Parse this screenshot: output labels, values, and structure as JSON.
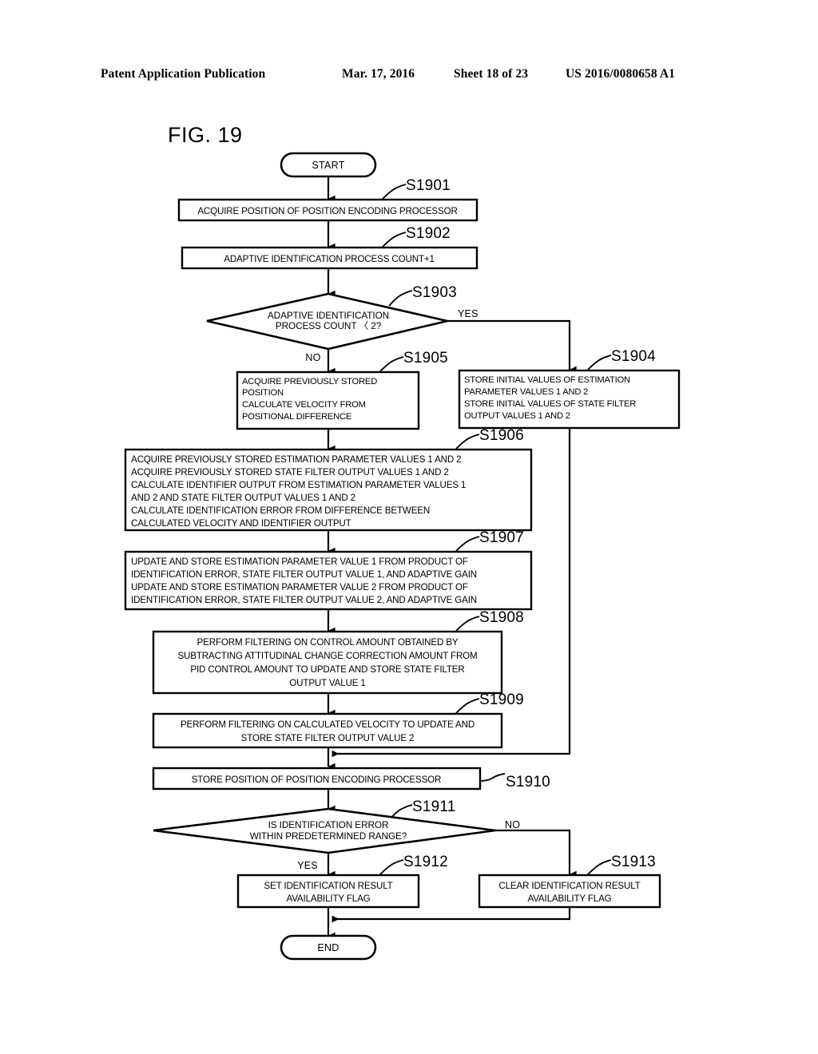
{
  "header": {
    "publication": "Patent Application Publication",
    "date": "Mar. 17, 2016",
    "sheet": "Sheet 18 of 23",
    "patent_number": "US 2016/0080658 A1"
  },
  "figure": {
    "title": "FIG. 19"
  },
  "chart_data": {
    "type": "diagram",
    "diagram_kind": "flowchart",
    "title": "FIG. 19",
    "nodes": [
      {
        "id": "start",
        "shape": "terminator",
        "label": "START"
      },
      {
        "id": "s1901",
        "shape": "process",
        "step": "S1901",
        "align": "center",
        "lines": [
          "ACQUIRE POSITION OF POSITION ENCODING PROCESSOR"
        ]
      },
      {
        "id": "s1902",
        "shape": "process",
        "step": "S1902",
        "align": "center",
        "lines": [
          "ADAPTIVE IDENTIFICATION PROCESS COUNT+1"
        ]
      },
      {
        "id": "s1903",
        "shape": "decision",
        "step": "S1903",
        "align": "center",
        "lines": [
          "ADAPTIVE IDENTIFICATION",
          "PROCESS COUNT 〈 2?"
        ],
        "branch_yes": "YES",
        "branch_no": "NO"
      },
      {
        "id": "s1905",
        "shape": "process",
        "step": "S1905",
        "align": "left",
        "lines": [
          "ACQUIRE PREVIOUSLY STORED",
          "POSITION",
          "CALCULATE VELOCITY FROM",
          "POSITIONAL DIFFERENCE"
        ]
      },
      {
        "id": "s1904",
        "shape": "process",
        "step": "S1904",
        "align": "left",
        "lines": [
          "STORE INITIAL VALUES OF ESTIMATION",
          "PARAMETER VALUES 1 AND 2",
          "STORE INITIAL VALUES OF STATE FILTER",
          "OUTPUT VALUES 1 AND 2"
        ]
      },
      {
        "id": "s1906",
        "shape": "process",
        "step": "S1906",
        "align": "left",
        "lines": [
          "ACQUIRE PREVIOUSLY STORED ESTIMATION PARAMETER VALUES 1 AND 2",
          "ACQUIRE PREVIOUSLY STORED STATE FILTER OUTPUT VALUES 1 AND 2",
          "CALCULATE IDENTIFIER OUTPUT FROM ESTIMATION PARAMETER VALUES 1",
          "AND 2 AND STATE FILTER OUTPUT VALUES 1 AND 2",
          "CALCULATE IDENTIFICATION ERROR FROM DIFFERENCE BETWEEN",
          "CALCULATED VELOCITY AND IDENTIFIER OUTPUT"
        ]
      },
      {
        "id": "s1907",
        "shape": "process",
        "step": "S1907",
        "align": "left",
        "lines": [
          "UPDATE AND STORE ESTIMATION PARAMETER VALUE 1 FROM PRODUCT OF",
          "IDENTIFICATION ERROR, STATE FILTER OUTPUT VALUE 1, AND ADAPTIVE GAIN",
          "UPDATE AND STORE ESTIMATION PARAMETER VALUE 2 FROM PRODUCT OF",
          "IDENTIFICATION ERROR, STATE FILTER OUTPUT VALUE 2, AND ADAPTIVE GAIN"
        ]
      },
      {
        "id": "s1908",
        "shape": "process",
        "step": "S1908",
        "align": "center",
        "lines": [
          "PERFORM FILTERING ON CONTROL AMOUNT OBTAINED BY",
          "SUBTRACTING ATTITUDINAL CHANGE CORRECTION AMOUNT FROM",
          "PID CONTROL AMOUNT TO UPDATE AND STORE STATE FILTER",
          "OUTPUT VALUE 1"
        ]
      },
      {
        "id": "s1909",
        "shape": "process",
        "step": "S1909",
        "align": "center",
        "lines": [
          "PERFORM FILTERING ON CALCULATED VELOCITY TO UPDATE AND",
          "STORE STATE FILTER OUTPUT VALUE 2"
        ]
      },
      {
        "id": "s1910",
        "shape": "process",
        "step": "S1910",
        "align": "center",
        "lines": [
          "STORE POSITION OF POSITION ENCODING PROCESSOR"
        ]
      },
      {
        "id": "s1911",
        "shape": "decision",
        "step": "S1911",
        "align": "center",
        "lines": [
          "IS IDENTIFICATION ERROR",
          "WITHIN PREDETERMINED RANGE?"
        ],
        "branch_yes": "YES",
        "branch_no": "NO"
      },
      {
        "id": "s1912",
        "shape": "process",
        "step": "S1912",
        "align": "center",
        "lines": [
          "SET IDENTIFICATION RESULT",
          "AVAILABILITY FLAG"
        ]
      },
      {
        "id": "s1913",
        "shape": "process",
        "step": "S1913",
        "align": "center",
        "lines": [
          "CLEAR IDENTIFICATION RESULT",
          "AVAILABILITY FLAG"
        ]
      },
      {
        "id": "end",
        "shape": "terminator",
        "label": "END"
      }
    ],
    "edges": [
      {
        "from": "start",
        "to": "s1901"
      },
      {
        "from": "s1901",
        "to": "s1902"
      },
      {
        "from": "s1902",
        "to": "s1903"
      },
      {
        "from": "s1903",
        "to": "s1905",
        "label": "NO"
      },
      {
        "from": "s1903",
        "to": "s1904",
        "label": "YES"
      },
      {
        "from": "s1905",
        "to": "s1906"
      },
      {
        "from": "s1906",
        "to": "s1907"
      },
      {
        "from": "s1907",
        "to": "s1908"
      },
      {
        "from": "s1908",
        "to": "s1909"
      },
      {
        "from": "s1909",
        "to": "s1910"
      },
      {
        "from": "s1904",
        "to": "s1910"
      },
      {
        "from": "s1910",
        "to": "s1911"
      },
      {
        "from": "s1911",
        "to": "s1912",
        "label": "YES"
      },
      {
        "from": "s1911",
        "to": "s1913",
        "label": "NO"
      },
      {
        "from": "s1912",
        "to": "end"
      },
      {
        "from": "s1913",
        "to": "end"
      }
    ],
    "colors": {
      "stroke": "#000000",
      "fill": "#ffffff",
      "text": "#000000"
    }
  },
  "labels": {
    "start": "START",
    "end": "END",
    "yes": "YES",
    "no": "NO",
    "s1901_step": "S1901",
    "s1902_step": "S1902",
    "s1903_step": "S1903",
    "s1904_step": "S1904",
    "s1905_step": "S1905",
    "s1906_step": "S1906",
    "s1907_step": "S1907",
    "s1908_step": "S1908",
    "s1909_step": "S1909",
    "s1910_step": "S1910",
    "s1911_step": "S1911",
    "s1912_step": "S1912",
    "s1913_step": "S1913",
    "s1901_l0": "ACQUIRE POSITION OF POSITION ENCODING PROCESSOR",
    "s1902_l0": "ADAPTIVE IDENTIFICATION PROCESS COUNT+1",
    "s1903_l0": "ADAPTIVE IDENTIFICATION",
    "s1903_l1": "PROCESS COUNT 〈 2?",
    "s1905_l0": "ACQUIRE PREVIOUSLY STORED",
    "s1905_l1": "POSITION",
    "s1905_l2": "CALCULATE VELOCITY FROM",
    "s1905_l3": "POSITIONAL DIFFERENCE",
    "s1904_l0": "STORE INITIAL VALUES OF ESTIMATION",
    "s1904_l1": "PARAMETER VALUES 1 AND 2",
    "s1904_l2": "STORE INITIAL VALUES OF STATE FILTER",
    "s1904_l3": "OUTPUT VALUES 1 AND 2",
    "s1906_l0": "ACQUIRE PREVIOUSLY STORED ESTIMATION PARAMETER VALUES 1 AND 2",
    "s1906_l1": "ACQUIRE PREVIOUSLY STORED STATE FILTER OUTPUT VALUES 1 AND 2",
    "s1906_l2": "CALCULATE IDENTIFIER OUTPUT FROM ESTIMATION PARAMETER VALUES 1",
    "s1906_l3": "AND 2 AND STATE FILTER OUTPUT VALUES 1 AND 2",
    "s1906_l4": "CALCULATE IDENTIFICATION ERROR FROM DIFFERENCE BETWEEN",
    "s1906_l5": "CALCULATED VELOCITY AND IDENTIFIER OUTPUT",
    "s1907_l0": "UPDATE AND STORE ESTIMATION PARAMETER VALUE 1 FROM PRODUCT OF",
    "s1907_l1": "IDENTIFICATION ERROR, STATE FILTER OUTPUT VALUE 1, AND ADAPTIVE GAIN",
    "s1907_l2": "UPDATE AND STORE ESTIMATION PARAMETER VALUE 2 FROM PRODUCT OF",
    "s1907_l3": "IDENTIFICATION ERROR, STATE FILTER OUTPUT VALUE 2, AND ADAPTIVE GAIN",
    "s1908_l0": "PERFORM FILTERING ON CONTROL AMOUNT OBTAINED BY",
    "s1908_l1": "SUBTRACTING ATTITUDINAL CHANGE CORRECTION AMOUNT FROM",
    "s1908_l2": "PID CONTROL AMOUNT TO UPDATE AND STORE STATE FILTER",
    "s1908_l3": "OUTPUT VALUE 1",
    "s1909_l0": "PERFORM FILTERING ON CALCULATED VELOCITY TO UPDATE AND",
    "s1909_l1": "STORE STATE FILTER OUTPUT VALUE 2",
    "s1910_l0": "STORE POSITION OF POSITION ENCODING PROCESSOR",
    "s1911_l0": "IS IDENTIFICATION ERROR",
    "s1911_l1": "WITHIN PREDETERMINED RANGE?",
    "s1912_l0": "SET IDENTIFICATION RESULT",
    "s1912_l1": "AVAILABILITY FLAG",
    "s1913_l0": "CLEAR IDENTIFICATION RESULT",
    "s1913_l1": "AVAILABILITY FLAG",
    "yes_s1903": "YES",
    "no_s1903": "NO",
    "yes_s1911": "YES",
    "no_s1911": "NO"
  }
}
